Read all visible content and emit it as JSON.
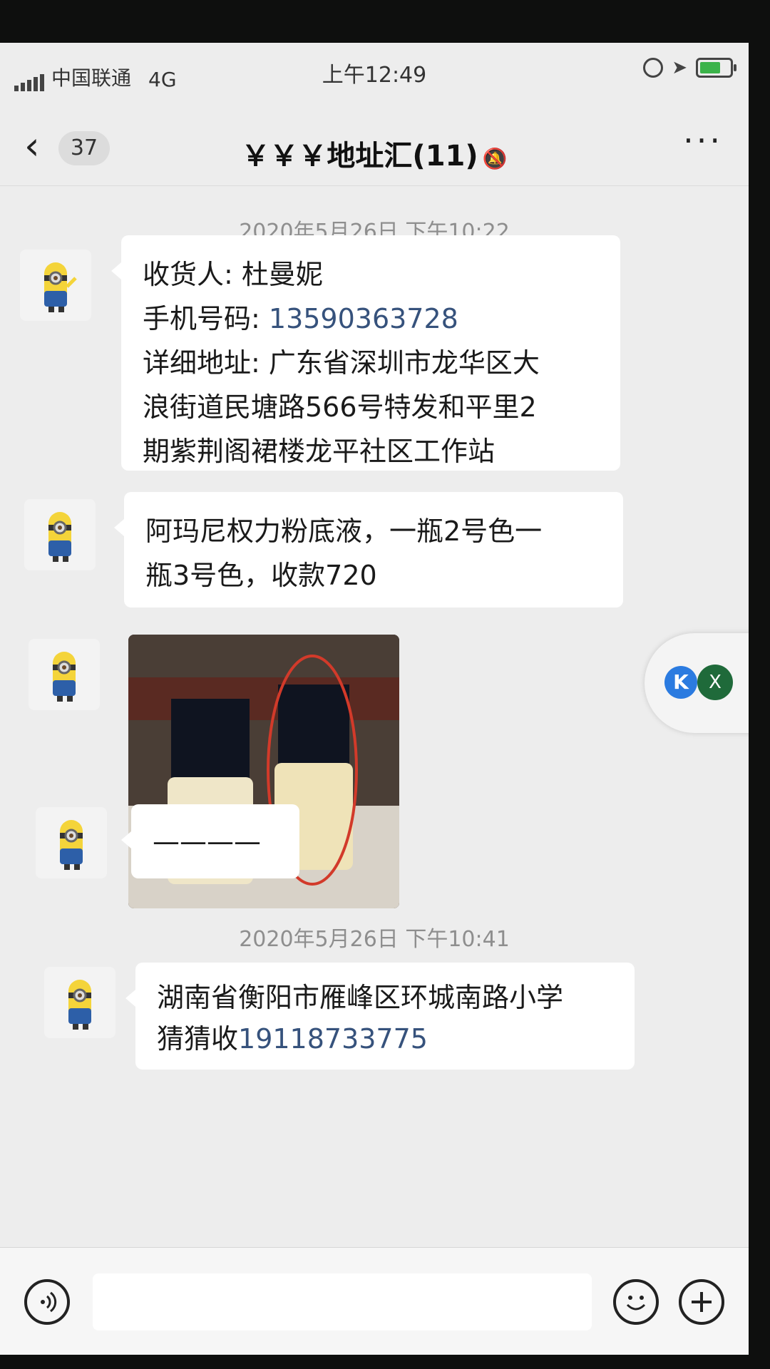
{
  "status_bar": {
    "carrier": "中国联通",
    "network": "4G",
    "time": "上午12:49",
    "battery_color": "#3bb34a"
  },
  "nav": {
    "back_icon": "chevron-left-icon",
    "unread_count": "37",
    "title": "￥￥￥地址汇(11)",
    "mute_icon": "bell-muted-icon",
    "more_icon": "ellipsis-icon"
  },
  "messages": {
    "timestamp1": "2020年5月26日 下午10:22",
    "msg1": {
      "line1": "收货人: 杜曼妮",
      "line2_prefix": "手机号码: ",
      "line2_phone": "13590363728",
      "line3": "详细地址: 广东省深圳市龙华区大",
      "line4": "浪街道民塘路566号特发和平里2",
      "line5": "期紫荆阁裙楼龙平社区工作站"
    },
    "msg2": {
      "line1": "阿玛尼权力粉底液，一瓶2号色一",
      "line2": "瓶3号色，收款720"
    },
    "msg4_text": "————",
    "timestamp2": "2020年5月26日 下午10:41",
    "msg5": {
      "line1": "湖南省衡阳市雁峰区环城南路小学",
      "line2_prefix": "猜猜收",
      "line2_phone": "19118733775"
    }
  },
  "floating": {
    "k_label": "K",
    "x_label": "X"
  },
  "input_bar": {
    "voice_icon": "voice-icon",
    "emoji_icon": "emoji-icon",
    "plus_icon": "plus-icon"
  },
  "colors": {
    "link": "#36527c",
    "bubble": "#ffffff",
    "background": "#ededed"
  }
}
